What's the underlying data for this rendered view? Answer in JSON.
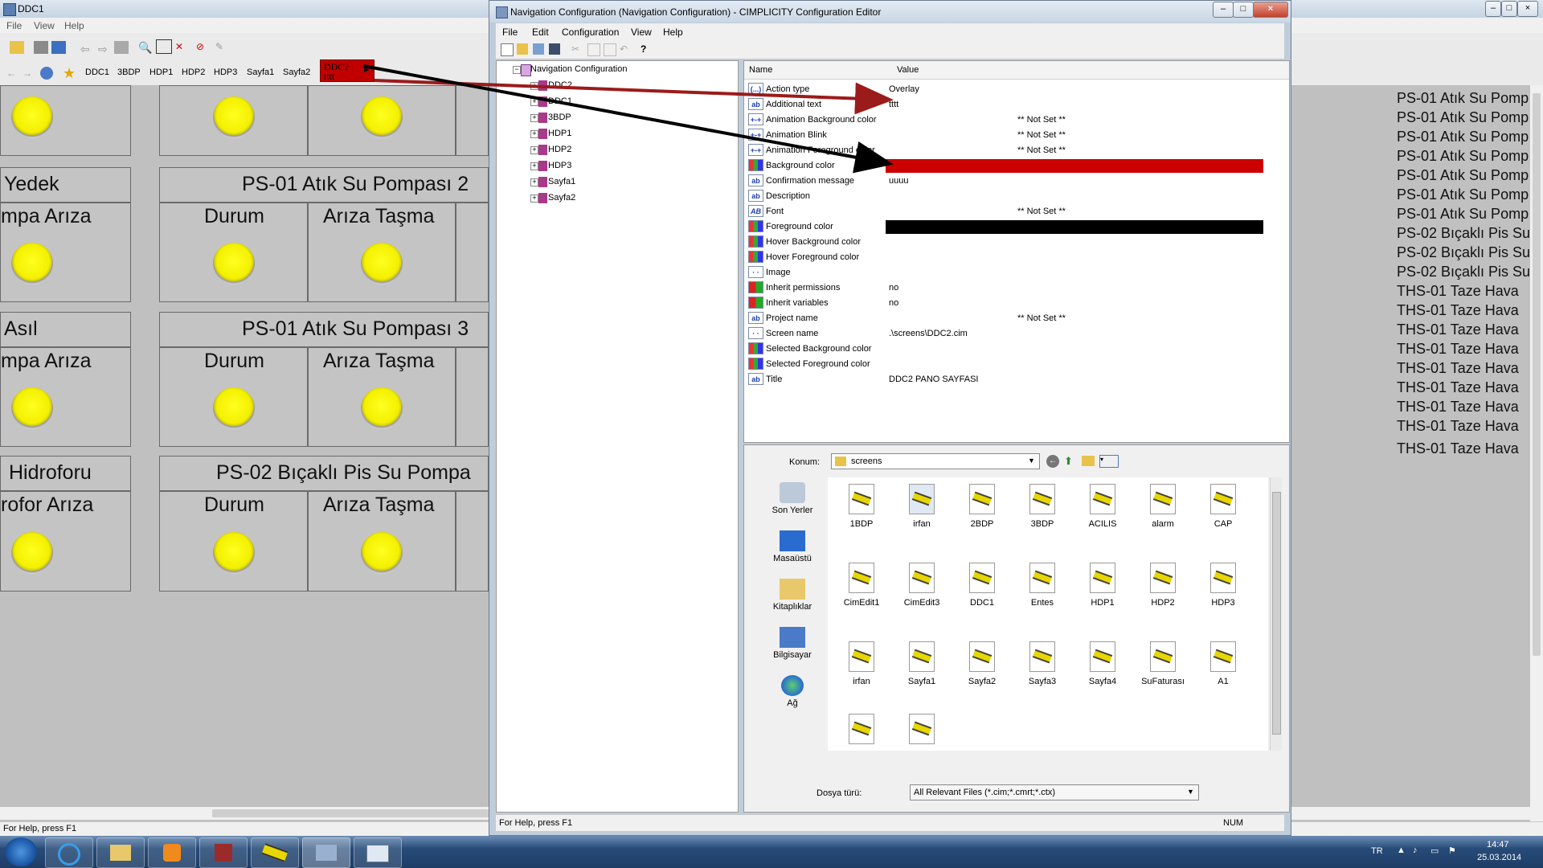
{
  "bg_window": {
    "title": "DDC1",
    "menu": [
      "File",
      "View",
      "Help"
    ],
    "nav_links": [
      "DDC1",
      "3BDP",
      "HDP1",
      "HDP2",
      "HDP3",
      "Sayfa1",
      "Sayfa2"
    ],
    "badge": {
      "line1": "DDC2",
      "line2": "tttt",
      "color": "#c00000"
    },
    "panels": [
      {
        "title": "Yedek",
        "sub": "mpa Arıza"
      },
      {
        "title": "PS-01 Atık Su Pompası 2",
        "col1": "Durum",
        "col2": "Arıza Taşma"
      },
      {
        "title": "Asıl",
        "sub": "mpa Arıza"
      },
      {
        "title": "PS-01 Atık Su Pompası 3",
        "col1": "Durum",
        "col2": "Arıza Taşma"
      },
      {
        "title": "Hidroforu",
        "sub": "rofor Arıza"
      },
      {
        "title": "PS-02 Bıçaklı Pis Su Pompa",
        "col1": "Durum",
        "col2": "Arıza Taşma"
      }
    ],
    "lamp_color": "#f3f000",
    "right_list": [
      "PS-01 Atık Su Pomp",
      "PS-01 Atık Su Pomp",
      "PS-01 Atık Su Pomp",
      "PS-01 Atık Su Pomp",
      "PS-01 Atık Su Pomp",
      "PS-01 Atık Su Pomp",
      "PS-01 Atık Su Pomp",
      "PS-02 Bıçaklı Pis Su",
      "PS-02 Bıçaklı Pis Su",
      "PS-02 Bıçaklı Pis Su",
      "THS-01 Taze Hava",
      "THS-01 Taze Hava",
      "THS-01 Taze Hava",
      "THS-01 Taze Hava",
      "THS-01 Taze Hava",
      "THS-01 Taze Hava",
      "THS-01 Taze Hava",
      "THS-01 Taze Hava",
      "THS-01 Taze Hava"
    ],
    "status": "For Help, press F1"
  },
  "window": {
    "title": "Navigation Configuration (Navigation Configuration) - CIMPLICITY Configuration Editor",
    "menu": [
      "File",
      "Edit",
      "Configuration",
      "View",
      "Help"
    ],
    "tree": {
      "root": "Navigation Configuration",
      "items": [
        "DDC2",
        "DDC1",
        "3BDP",
        "HDP1",
        "HDP2",
        "HDP3",
        "Sayfa1",
        "Sayfa2"
      ]
    },
    "props": {
      "col_name": "Name",
      "col_value": "Value",
      "not_set": "** Not Set **",
      "rows": [
        {
          "icon": "(...)",
          "name": "Action type",
          "value": "Overlay"
        },
        {
          "icon": "ab",
          "name": "Additional text",
          "value": "tttt"
        },
        {
          "icon": "+-+",
          "name": "Animation Background color",
          "value": "** Not Set **"
        },
        {
          "icon": "+-+",
          "name": "Animation Blink",
          "value": "** Not Set **"
        },
        {
          "icon": "+-+",
          "name": "Animation Foreground color",
          "value": "** Not Set **"
        },
        {
          "icon": "grid",
          "name": "Background color",
          "color": "#cc0000"
        },
        {
          "icon": "ab",
          "name": "Confirmation message",
          "value": "uuuu"
        },
        {
          "icon": "ab",
          "name": "Description",
          "value": ""
        },
        {
          "icon": "AB",
          "name": "Font",
          "value": "** Not Set **"
        },
        {
          "icon": "grid",
          "name": "Foreground color",
          "color": "#000000"
        },
        {
          "icon": "grid",
          "name": "Hover Background color",
          "value": ""
        },
        {
          "icon": "grid",
          "name": "Hover Foreground color",
          "value": ""
        },
        {
          "icon": "img",
          "name": "Image",
          "value": ""
        },
        {
          "icon": "rg",
          "name": "Inherit permissions",
          "value": "no"
        },
        {
          "icon": "rg",
          "name": "Inherit variables",
          "value": "no"
        },
        {
          "icon": "ab",
          "name": "Project name",
          "value": "** Not Set **"
        },
        {
          "icon": "img",
          "name": "Screen name",
          "value": ".\\screens\\DDC2.cim"
        },
        {
          "icon": "grid",
          "name": "Selected Background color",
          "value": ""
        },
        {
          "icon": "grid",
          "name": "Selected Foreground color",
          "value": ""
        },
        {
          "icon": "ab",
          "name": "Title",
          "value": "DDC2 PANO SAYFASI"
        }
      ]
    },
    "dialog": {
      "location_label": "Konum:",
      "location_value": "screens",
      "places": [
        "Son Yerler",
        "Masaüstü",
        "Kitaplıklar",
        "Bilgisayar",
        "Ağ"
      ],
      "files": [
        "1BDP",
        "irfan",
        "2BDP",
        "3BDP",
        "ACILIS",
        "alarm",
        "CAP",
        "CimEdit1",
        "CimEdit3",
        "DDC1",
        "Entes",
        "HDP1",
        "HDP2",
        "HDP3",
        "irfan",
        "Sayfa1",
        "Sayfa2",
        "Sayfa3",
        "Sayfa4",
        "SuFaturası",
        "A1",
        "",
        ""
      ],
      "filetype_label": "Dosya türü:",
      "filetype_value": "All Relevant Files (*.cim;*.cmrt;*.ctx)"
    },
    "status": "For Help, press F1",
    "status_right": "NUM"
  },
  "taskbar": {
    "lang": "TR",
    "time": "14:47",
    "date": "25.03.2014"
  },
  "annotation": {
    "red_arrow_color": "#9b1b1b",
    "black_arrow_color": "#000000"
  }
}
